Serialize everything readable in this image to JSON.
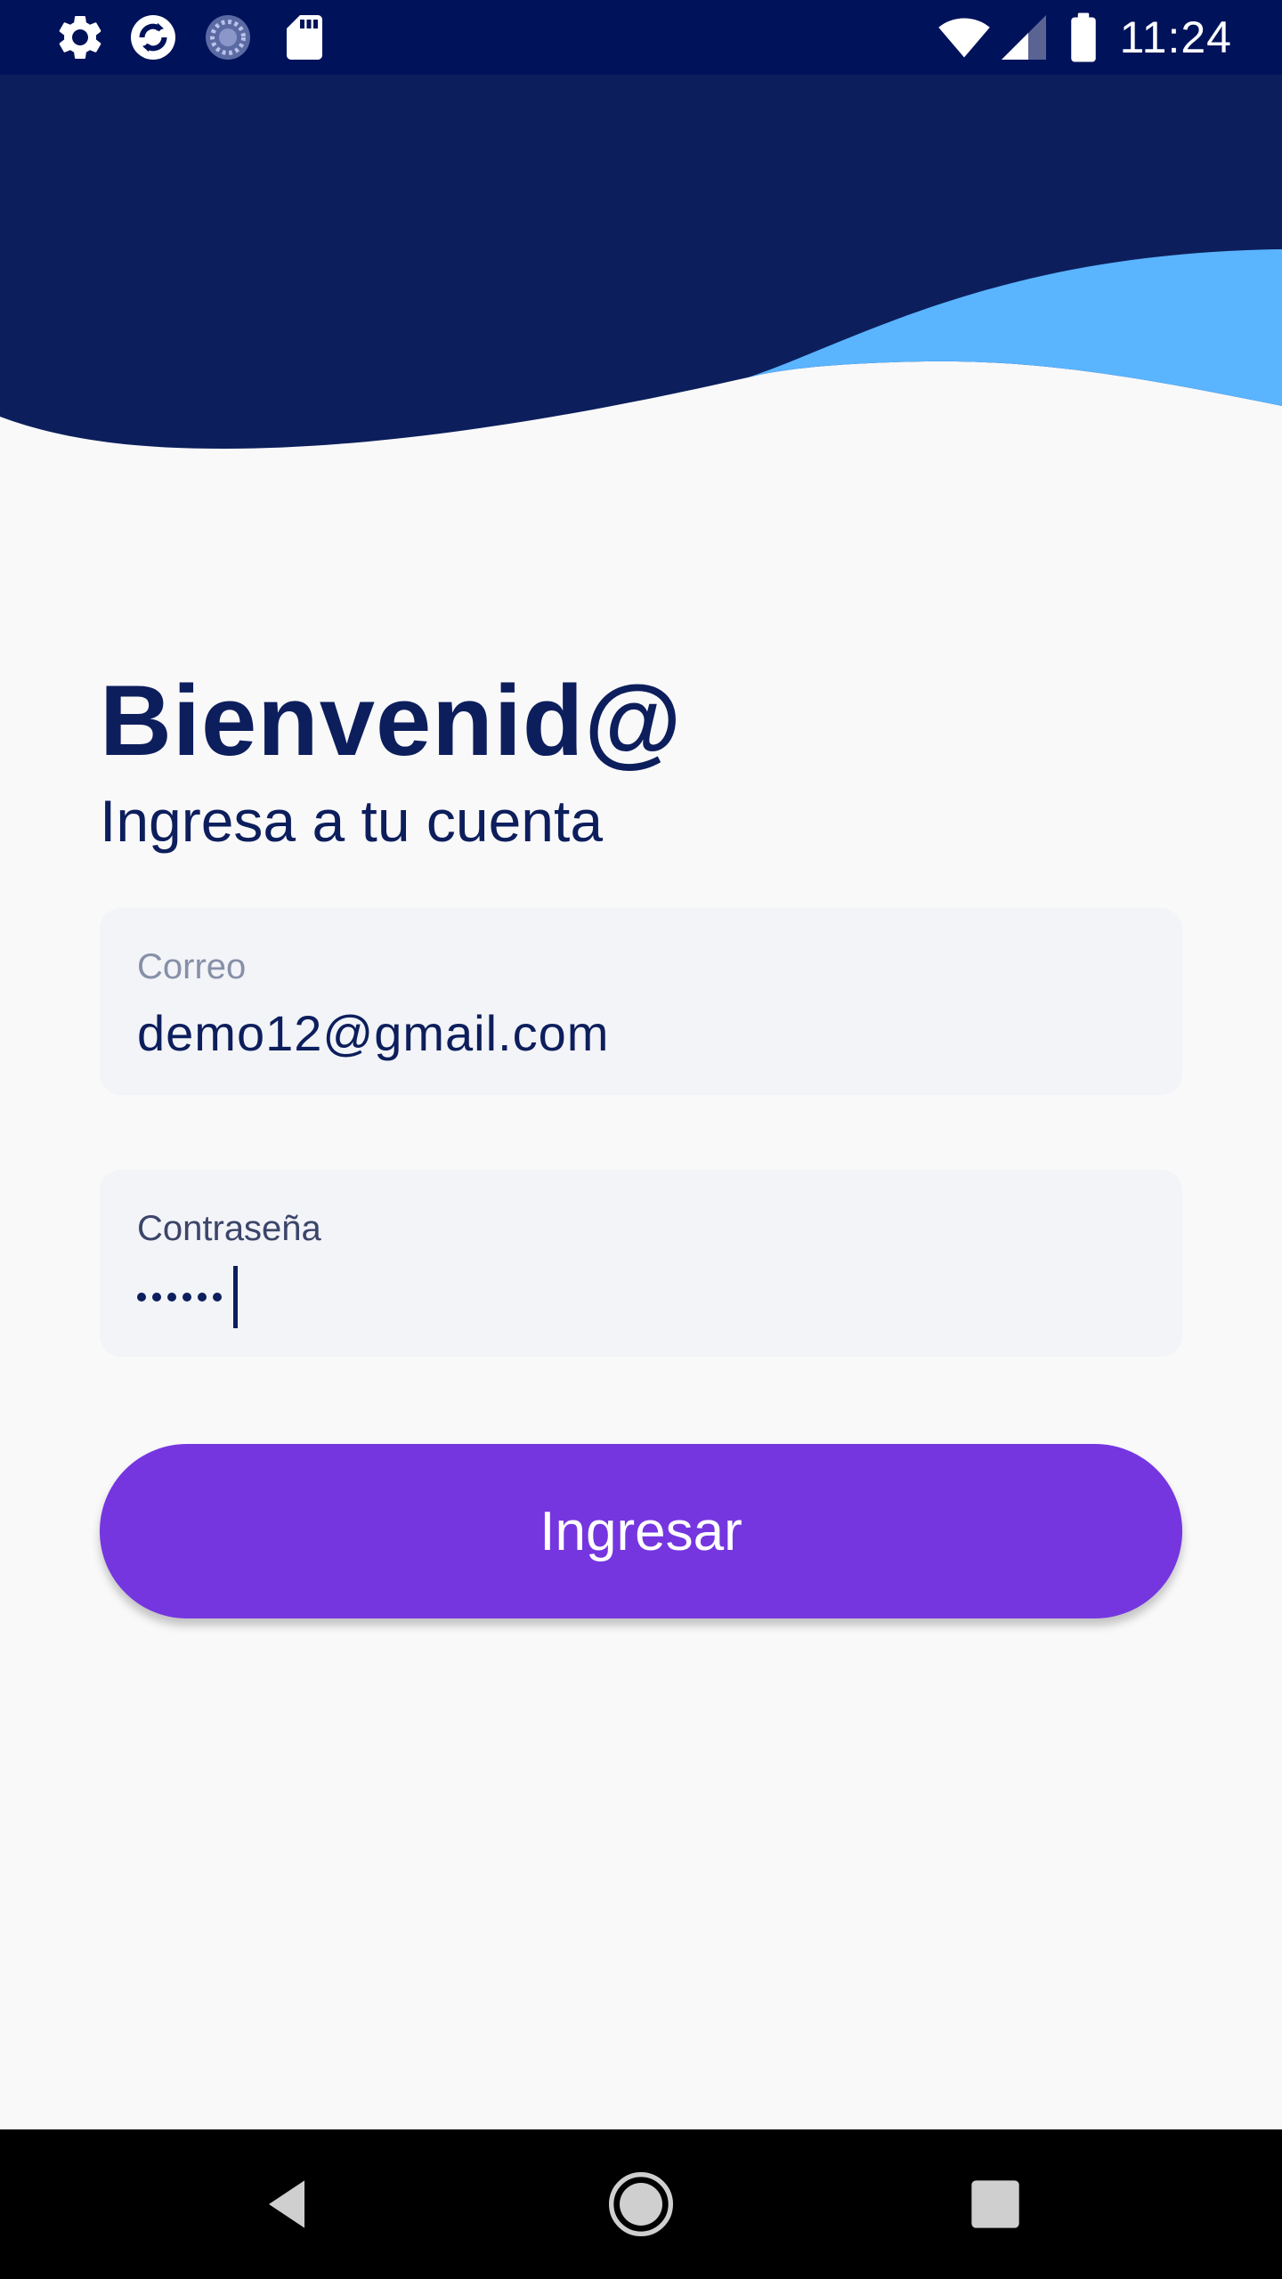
{
  "status_bar": {
    "time": "11:24",
    "left_icons": [
      "gear-icon",
      "sync-icon",
      "loading-icon",
      "sd-card-icon"
    ],
    "right_icons": [
      "wifi-icon",
      "cell-signal-icon",
      "battery-icon"
    ]
  },
  "colors": {
    "status_bar": "#00125a",
    "header_navy": "#0c1f5c",
    "header_wave": "#5ab4fe",
    "text_primary": "#0d1e5c",
    "field_bg": "#f2f4f8",
    "button": "#7536e0",
    "background": "#f9f9fa"
  },
  "login": {
    "title": "Bienvenid@",
    "subtitle": "Ingresa a tu cuenta",
    "email": {
      "label": "Correo",
      "value": "demo12@gmail.com"
    },
    "password": {
      "label": "Contraseña",
      "masked_length": 6
    },
    "submit_label": "Ingresar"
  },
  "nav_bar": {
    "buttons": [
      "back-icon",
      "home-icon",
      "recents-icon"
    ]
  }
}
